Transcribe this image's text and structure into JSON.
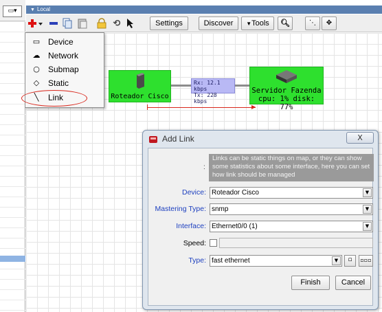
{
  "group": {
    "title": "Local"
  },
  "left_panel": {
    "dropdown_icon": "window-dropdown-icon"
  },
  "toolbar": {
    "add_icon": "plus-icon",
    "remove_icon": "minus-icon",
    "copy_icon": "copy-icon",
    "paste_icon": "paste-icon",
    "lock_icon": "lock-icon",
    "rotate_icon": "rotate-icon",
    "pointer_icon": "pointer-icon",
    "settings_label": "Settings",
    "discover_label": "Discover",
    "tools_label": "Tools",
    "find_icon": "binoculars-icon",
    "extra_icons": [
      "dots-icon",
      "arrows-icon"
    ]
  },
  "add_menu": {
    "items": [
      {
        "label": "Device",
        "icon": "rectangle-icon"
      },
      {
        "label": "Network",
        "icon": "cloud-icon"
      },
      {
        "label": "Submap",
        "icon": "circle-icon"
      },
      {
        "label": "Static",
        "icon": "diamond-icon"
      },
      {
        "label": "Link",
        "icon": "line-icon"
      }
    ]
  },
  "map": {
    "devices": [
      {
        "name": "Roteador Cisco",
        "detail": ""
      },
      {
        "name": "Servidor Fazenda",
        "detail": "cpu: 1% disk: 77%"
      }
    ],
    "link": {
      "rx": "Rx: 12.1 kbps",
      "tx": "Tx: 228 kbps"
    }
  },
  "dialog": {
    "title": "Add Link",
    "close_label": "X",
    "info_colon": ":",
    "info_text": "Links can be static things on map, or they can show some statistics about some interface, here you can set how link should be managed",
    "device_label": "Device:",
    "device_value": "Roteador Cisco",
    "mastering_label": "Mastering Type:",
    "mastering_value": "snmp",
    "interface_label": "Interface:",
    "interface_value": "Ethernet0/0 (1)",
    "speed_label": "Speed:",
    "type_label": "Type:",
    "type_value": "fast ethernet",
    "finish_label": "Finish",
    "cancel_label": "Cancel"
  },
  "colors": {
    "device_green": "#2ee02e",
    "link_label_bg": "#b9b9f5",
    "annotation_red": "#d8261b",
    "info_bg": "#9a9a9a",
    "group_header": "#5a7fb0"
  }
}
